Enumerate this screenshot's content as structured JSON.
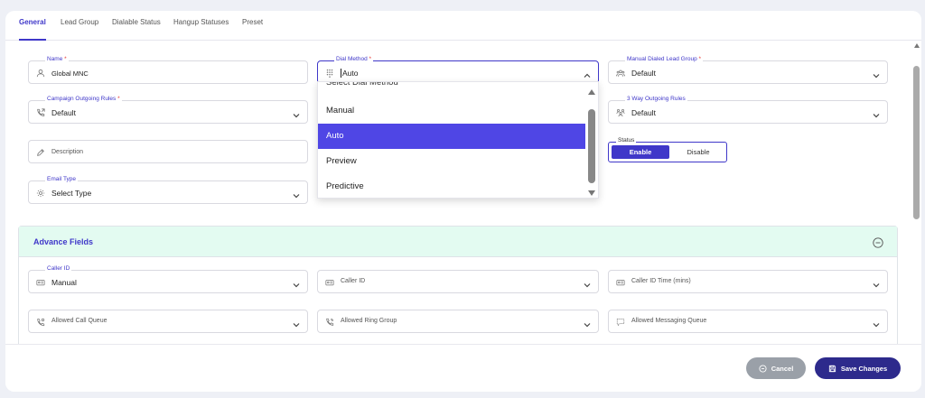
{
  "tabs": [
    {
      "label": "General"
    },
    {
      "label": "Lead Group"
    },
    {
      "label": "Dialable Status"
    },
    {
      "label": "Hangup Statuses"
    },
    {
      "label": "Preset"
    }
  ],
  "fields": {
    "name": {
      "label": "Name",
      "required": "*",
      "value": "Global MNC"
    },
    "dial_method": {
      "label": "Dial Method",
      "required": "*",
      "value": "Auto"
    },
    "manual_lead_group": {
      "label": "Manual Dialed Lead Group",
      "required": "*",
      "value": "Default"
    },
    "campaign_rules": {
      "label": "Campaign Outgoing Rules",
      "required": "*",
      "value": "Default"
    },
    "three_way_rules": {
      "label": "3 Way Outgoing Rules",
      "value": "Default"
    },
    "description": {
      "placeholder": "Description"
    },
    "email_type": {
      "label": "Email Type",
      "value": "Select Type"
    }
  },
  "dial_method_options": [
    "Select Dial Method",
    "Manual",
    "Auto",
    "Preview",
    "Predictive"
  ],
  "dial_method_selected": "Auto",
  "status": {
    "label": "Status",
    "enable": "Enable",
    "disable": "Disable",
    "selected": "Enable"
  },
  "advance": {
    "title": "Advance Fields",
    "caller_id_select": {
      "label": "Caller ID",
      "value": "Manual"
    },
    "caller_id": {
      "placeholder": "Caller ID"
    },
    "caller_id_time": {
      "placeholder": "Caller ID Time (mins)"
    },
    "allowed_call_queue": {
      "placeholder": "Allowed Call Queue"
    },
    "allowed_ring_group": {
      "placeholder": "Allowed Ring Group"
    },
    "allowed_messaging_queue": {
      "placeholder": "Allowed Messaging Queue"
    }
  },
  "footer": {
    "cancel": "Cancel",
    "save": "Save Changes"
  },
  "colors": {
    "accent": "#3f37c9",
    "selected": "#4f46e5",
    "advance_bg": "#e3fbf1",
    "save_bg": "#2d2a8c",
    "cancel_bg": "#9aa0a8"
  }
}
